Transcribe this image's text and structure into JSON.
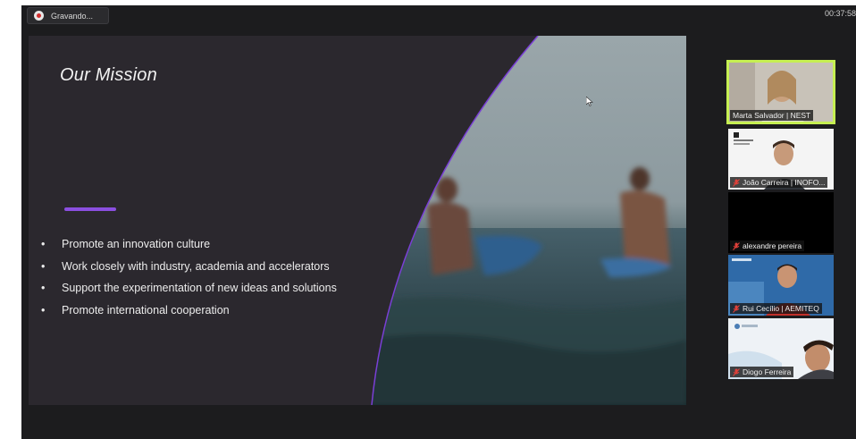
{
  "recording": {
    "label": "Gravando..."
  },
  "timer": "00:37:58",
  "slide": {
    "title": "Our Mission",
    "bullets": [
      "Promote an innovation culture",
      "Work closely with industry, academia and accelerators",
      "Support the experimentation of new ideas and solutions",
      "Promote international cooperation"
    ]
  },
  "participants": [
    {
      "name": "Marta Salvador | NEST",
      "muted": false,
      "active": true
    },
    {
      "name": "João Carreira | INOFO...",
      "muted": true,
      "active": false
    },
    {
      "name": "alexandre pereira",
      "muted": true,
      "active": false
    },
    {
      "name": "Rui Cecílio | AEMITEQ",
      "muted": true,
      "active": false
    },
    {
      "name": "Diogo Ferreira",
      "muted": true,
      "active": false
    }
  ],
  "colors": {
    "accent": "#8b4fe0",
    "active_speaker": "#c6ef52",
    "muted": "#e0403a"
  }
}
